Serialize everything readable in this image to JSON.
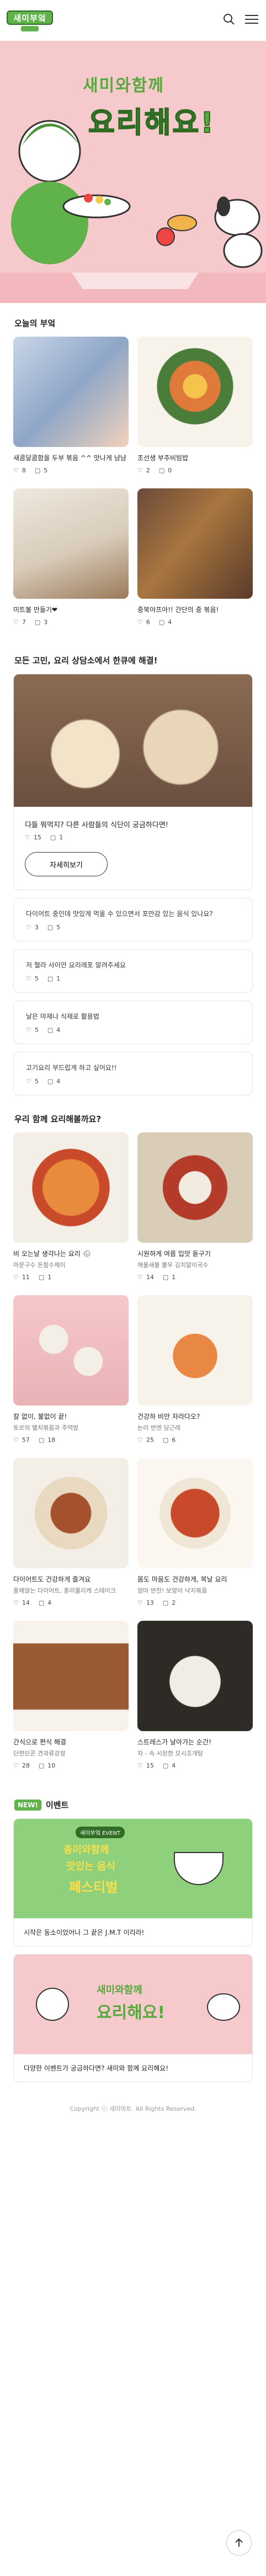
{
  "header": {
    "logo_text": "새미부엌",
    "search_icon": "search-icon",
    "menu_icon": "hamburger-menu-icon"
  },
  "hero": {
    "line1": "새미와함께",
    "line2": "요리해요!"
  },
  "today": {
    "title": "오늘의 부엌",
    "items": [
      {
        "name": "새콤달콤함을 두부 볶음 ^^ 맛나게 냠냠",
        "likes": "8",
        "comments": "5"
      },
      {
        "name": "조선생 부추비빔밥",
        "likes": "2",
        "comments": "0"
      },
      {
        "name": "미트볼 만들기❤",
        "likes": "7",
        "comments": "3"
      },
      {
        "name": "중북아프아!! 간단의 중 볶음!",
        "likes": "6",
        "comments": "4"
      }
    ]
  },
  "consult": {
    "title": "모든 고민, 요리 상담소에서 한큐에 해결!",
    "main_q": "다들 뭐먹지? 다른 사람들의 식단이 궁금하다면!",
    "main_likes": "15",
    "main_comments": "1",
    "more_label": "자세히보기",
    "questions": [
      {
        "q": "다이어트 중인데 맛있게 먹을 수 있으면서 포만감 있는 음식 있나요?",
        "likes": "3",
        "comments": "5"
      },
      {
        "q": "저 혈라 사이안 요리레포 알려주세요",
        "likes": "5",
        "comments": "1"
      },
      {
        "q": "날은 마재나 식재로 활용법",
        "likes": "5",
        "comments": "4"
      },
      {
        "q": "고기요리 부드럽게 하고 싶어요!!",
        "likes": "5",
        "comments": "4"
      }
    ]
  },
  "cook": {
    "title": "우리 함께 요리해볼까요?",
    "items": [
      {
        "name": "비 오는날 생각나는 요리 🌧",
        "author": "마문구수 돈함수제이",
        "likes": "11",
        "comments": "1"
      },
      {
        "name": "시원하게 여름 입맛 돋구기",
        "author": "해물새볼 볼우 김치말이국수",
        "likes": "14",
        "comments": "1"
      },
      {
        "name": "칼 없이, 불없이 끝!",
        "author": "토르의 멜치볶음과 주먹밥",
        "likes": "57",
        "comments": "18"
      },
      {
        "name": "건강하 비만 자라다오?",
        "author": "논리 번엔 당근레",
        "likes": "25",
        "comments": "6"
      },
      {
        "name": "다이어트도 건강하게 즐겨요",
        "author": "홈해않는 다이어트, 훈리물리캐 스테이크",
        "likes": "14",
        "comments": "4"
      },
      {
        "name": "몸도 마음도 건강하게, 복날 요리",
        "author": "엄마 반찬! 보양이 낙지볶음",
        "likes": "13",
        "comments": "2"
      },
      {
        "name": "간식으로 편식 해결",
        "author": "단편인콘 견과류강정",
        "likes": "28",
        "comments": "10"
      },
      {
        "name": "스트레스가 날아가는 순간!",
        "author": "자 - 속 시원한 모시조개탕",
        "likes": "15",
        "comments": "4"
      }
    ]
  },
  "event": {
    "new_label": "NEW!",
    "title": "이벤트",
    "items": [
      {
        "badge": "새미부엌 EVENT",
        "b1": "총미와함께",
        "b2": "맛있는 음식",
        "b3": "페스티벌",
        "caption": "시작은 동소이었어나 그 끝은 J.M.T 이리라!"
      },
      {
        "b1": "새미와함께",
        "b2": "요리해요!",
        "caption": "다양한 이벤트가 궁금하다면? 새미와 함께 요리해요!"
      }
    ]
  },
  "footer": {
    "copyright": "Copyright ⓒ 새미마트. All Rights Reserved."
  }
}
